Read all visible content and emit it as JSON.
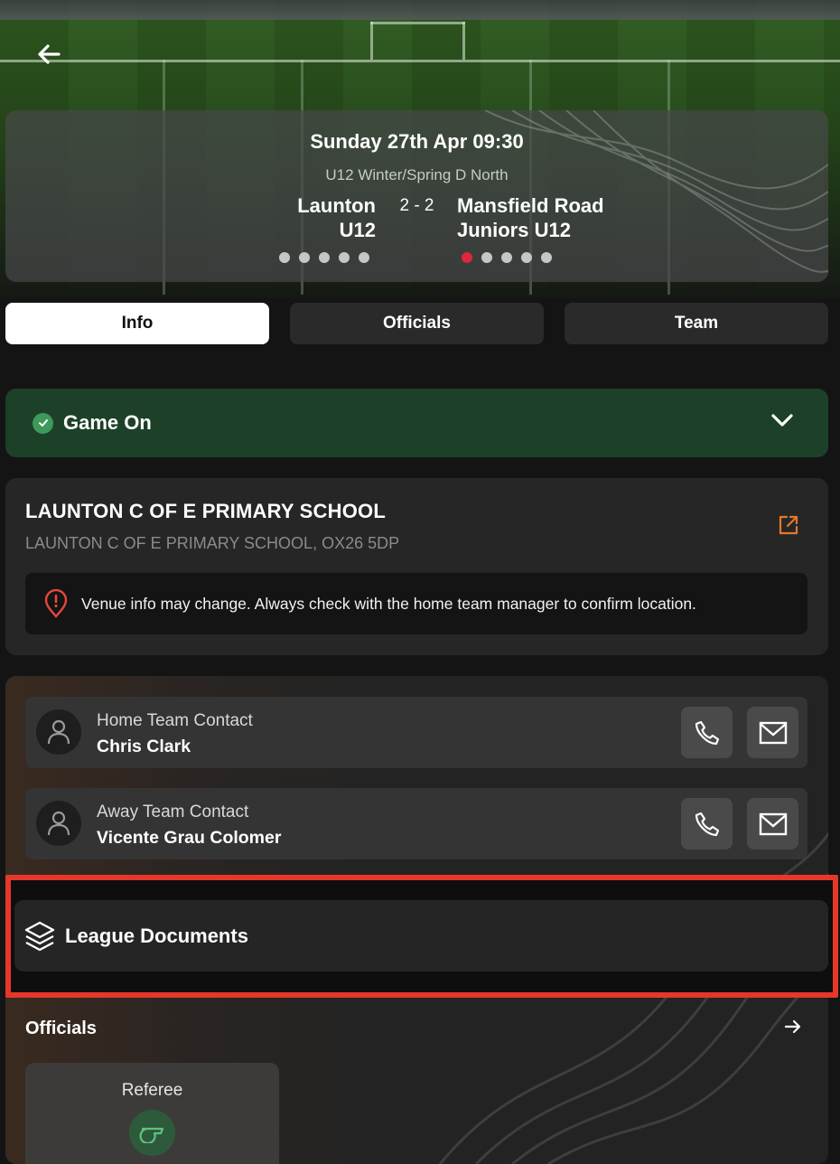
{
  "header": {
    "back_icon": "arrow-left-icon"
  },
  "match": {
    "date": "Sunday 27th Apr 09:30",
    "league": "U12 Winter/Spring D North",
    "home_team_line1": "Launton",
    "home_team_line2": "U12",
    "away_team_line1": "Mansfield Road",
    "away_team_line2": "Juniors U12",
    "score": "2 - 2",
    "home_form_dots": 5,
    "away_form_dots": 5,
    "accent_color": "#e0263b"
  },
  "tabs": [
    {
      "label": "Info",
      "active": true
    },
    {
      "label": "Officials",
      "active": false
    },
    {
      "label": "Team",
      "active": false
    }
  ],
  "status": {
    "label": "Game On",
    "icon": "check-circle-icon",
    "color": "#1d4029"
  },
  "venue": {
    "name": "LAUNTON C OF E PRIMARY SCHOOL",
    "address": "LAUNTON C OF E PRIMARY SCHOOL, OX26 5DP",
    "warning": "Venue info may change. Always check with the home team manager to confirm location.",
    "link_icon": "external-link-icon",
    "link_color": "#e2782f"
  },
  "contacts": [
    {
      "role": "Home Team Contact",
      "name": "Chris Clark"
    },
    {
      "role": "Away Team Contact",
      "name": "Vicente Grau Colomer"
    }
  ],
  "league_documents": {
    "label": "League Documents",
    "icon": "layers-icon",
    "highlight_color": "#e5372a"
  },
  "officials": {
    "title": "Officials",
    "referee_label": "Referee",
    "referee_icon": "whistle-icon"
  }
}
